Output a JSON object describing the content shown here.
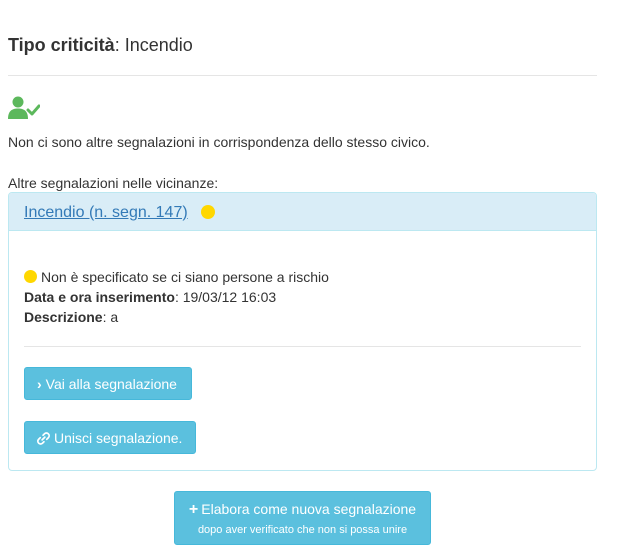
{
  "header": {
    "label": "Tipo criticità",
    "separator": ":",
    "value": "Incendio"
  },
  "icons": {
    "user_check": "user-check-icon",
    "chevron": "chevron-right-icon",
    "link": "link-icon",
    "plus": "plus-icon"
  },
  "colors": {
    "user_icon": "#5cb85c",
    "status_dot": "#ffd700",
    "panel_heading_bg": "#d9edf7",
    "panel_border": "#bce8f1",
    "button_bg": "#5bc0de",
    "link": "#337ab7"
  },
  "messages": {
    "no_reports": "Non ci sono altre segnalazioni in corrispondenza dello stesso civico.",
    "nearby_label": "Altre segnalazioni nelle vicinanze:"
  },
  "report": {
    "title_link": "Incendio (n. segn. 147)",
    "risk_text": "Non è specificato se ci siano persone a rischio",
    "date_label": "Data e ora inserimento",
    "date_value": ": 19/03/12 16:03",
    "desc_label": "Descrizione",
    "desc_value": ": a",
    "goto_button": "Vai alla segnalazione",
    "merge_button": "Unisci segnalazione."
  },
  "new_report_button": {
    "line1": "Elabora come nuova segnalazione",
    "line2": "dopo aver verificato che non si possa unire"
  }
}
